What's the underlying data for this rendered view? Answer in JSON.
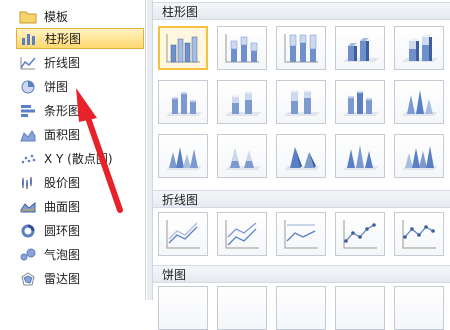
{
  "sidebar": {
    "items": [
      {
        "label": "模板",
        "icon": "folder-icon"
      },
      {
        "label": "柱形图",
        "icon": "column-chart-icon",
        "selected": true
      },
      {
        "label": "折线图",
        "icon": "line-chart-icon"
      },
      {
        "label": "饼图",
        "icon": "pie-chart-icon"
      },
      {
        "label": "条形图",
        "icon": "bar-chart-icon"
      },
      {
        "label": "面积图",
        "icon": "area-chart-icon"
      },
      {
        "label": "X Y (散点图)",
        "icon": "scatter-chart-icon"
      },
      {
        "label": "股价图",
        "icon": "stock-chart-icon"
      },
      {
        "label": "曲面图",
        "icon": "surface-chart-icon"
      },
      {
        "label": "圆环图",
        "icon": "doughnut-chart-icon"
      },
      {
        "label": "气泡图",
        "icon": "bubble-chart-icon"
      },
      {
        "label": "雷达图",
        "icon": "radar-chart-icon"
      }
    ]
  },
  "main": {
    "sections": [
      {
        "title": "柱形图"
      },
      {
        "title": "折线图"
      },
      {
        "title": "饼图"
      }
    ]
  },
  "colors": {
    "selected_fill": "#ffd870",
    "selected_border": "#e5b13a",
    "chart_blue": "#5b7fc4",
    "arrow_red": "#e8222a"
  }
}
